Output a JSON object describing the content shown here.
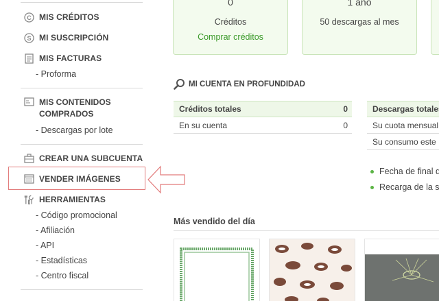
{
  "sidebar": {
    "mis_creditos": "MIS CRÉDITOS",
    "mi_suscripcion": "MI SUSCRIPCIÓN",
    "mis_facturas": "MIS FACTURAS",
    "proforma": "- Proforma",
    "mis_contenidos_1": "MIS CONTENIDOS",
    "mis_contenidos_2": "COMPRADOS",
    "descargas_lote": "- Descargas por lote",
    "crear_subcuenta": "CREAR UNA SUBCUENTA",
    "vender_imagenes": "VENDER IMÁGENES",
    "herramientas": "HERRAMIENTAS",
    "tools": [
      "- Código promocional",
      "- Afiliación",
      "- API",
      "- Estadísticas",
      "- Centro fiscal"
    ]
  },
  "cards": [
    {
      "big": "0",
      "line1": "Créditos",
      "line2": "Comprar créditos"
    },
    {
      "big": "1 año",
      "line1": "50 descargas al mes",
      "line2": ""
    }
  ],
  "account": {
    "title": "MI CUENTA EN PROFUNDIDAD",
    "credits_table": {
      "header_label": "Créditos totales",
      "header_value": "0",
      "row_label": "En su cuenta",
      "row_value": "0"
    },
    "downloads_table": {
      "header_label": "Descargas totales",
      "row1": "Su cuota mensual",
      "row2": "Su consumo este"
    },
    "bullets": [
      "Fecha de final d",
      "Recarga de la s"
    ]
  },
  "best_seller": {
    "title": "Más vendido del día"
  },
  "colors": {
    "accent_green": "#3b9a2a",
    "card_bg": "#f3fbee",
    "highlight_red": "#e27b7b"
  }
}
